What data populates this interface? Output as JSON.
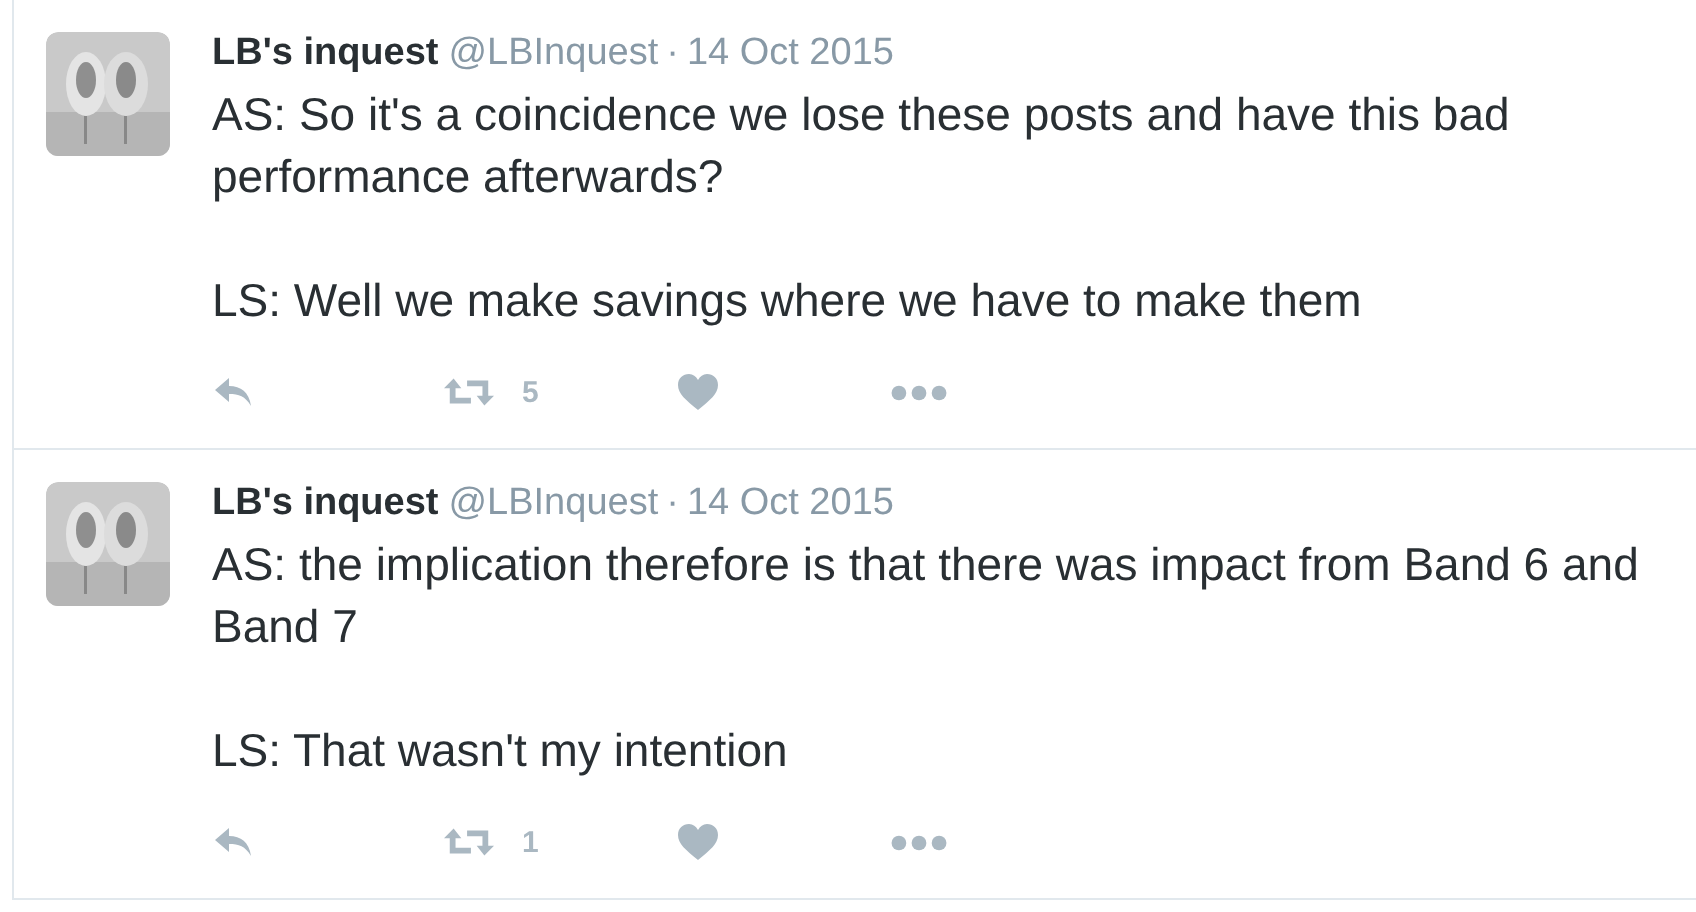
{
  "tweets": [
    {
      "name": "LB's inquest",
      "handle": "@LBInquest",
      "separator": "·",
      "date": "14 Oct 2015",
      "paragraphs": [
        "AS: So it's a coincidence we lose these posts and have this bad performance afterwards?",
        "LS: Well we make savings where we have to make them"
      ],
      "retweets": "5"
    },
    {
      "name": "LB's inquest",
      "handle": "@LBInquest",
      "separator": "·",
      "date": "14 Oct 2015",
      "paragraphs": [
        "AS: the implication therefore is that there was impact from Band 6 and Band 7",
        "LS: That wasn't my intention"
      ],
      "retweets": "1"
    }
  ]
}
